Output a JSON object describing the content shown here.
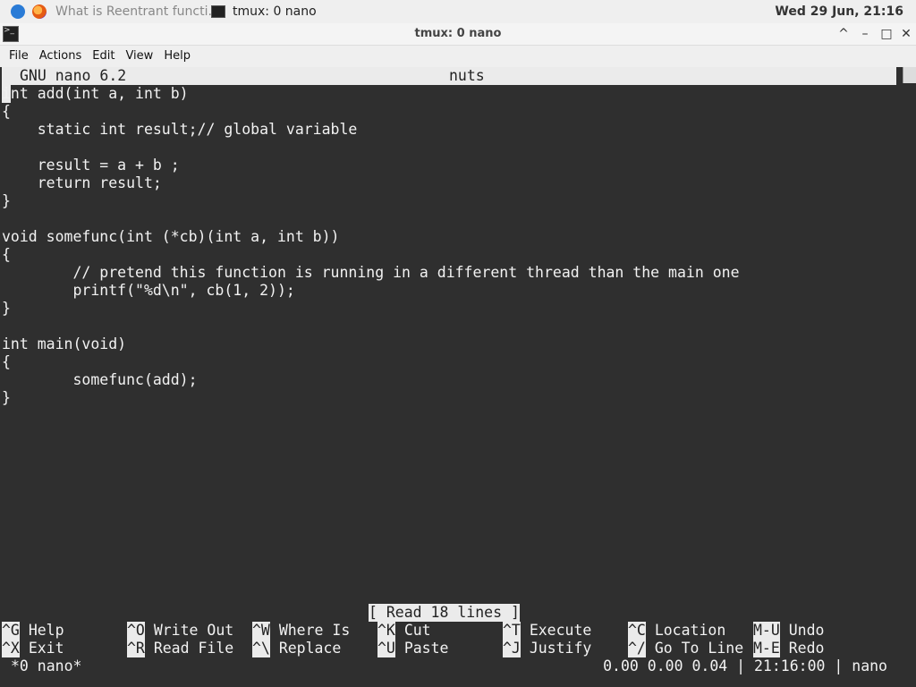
{
  "taskbar": {
    "firefox_task": "What is Reentrant functi...",
    "tmux_task": "tmux: 0 nano",
    "clock": "Wed 29 Jun, 21:16"
  },
  "window": {
    "title": "tmux: 0 nano",
    "buttons": {
      "up": "^",
      "minimize": "–",
      "maximize": "□",
      "close": "✕"
    }
  },
  "menu": [
    "File",
    "Actions",
    "Edit",
    "View",
    "Help"
  ],
  "nano": {
    "version": "GNU nano 6.2",
    "filename": "nuts",
    "code_lines": [
      "int add(int a, int b)",
      "{",
      "    static int result;// global variable",
      "",
      "    result = a + b ;",
      "    return result;",
      "}",
      "",
      "void somefunc(int (*cb)(int a, int b))",
      "{",
      "        // pretend this function is running in a different thread than the main one",
      "        printf(\"%d\\n\", cb(1, 2));",
      "}",
      "",
      "int main(void)",
      "{",
      "        somefunc(add);",
      "}"
    ],
    "status_message": "[ Read 18 lines ]",
    "shortcuts_row1": [
      {
        "key": "^G",
        "label": "Help"
      },
      {
        "key": "^O",
        "label": "Write Out"
      },
      {
        "key": "^W",
        "label": "Where Is"
      },
      {
        "key": "^K",
        "label": "Cut"
      },
      {
        "key": "^T",
        "label": "Execute"
      },
      {
        "key": "^C",
        "label": "Location"
      },
      {
        "key": "M-U",
        "label": "Undo"
      }
    ],
    "shortcuts_row2": [
      {
        "key": "^X",
        "label": "Exit"
      },
      {
        "key": "^R",
        "label": "Read File"
      },
      {
        "key": "^\\",
        "label": "Replace"
      },
      {
        "key": "^U",
        "label": "Paste"
      },
      {
        "key": "^J",
        "label": "Justify"
      },
      {
        "key": "^/",
        "label": "Go To Line"
      },
      {
        "key": "M-E",
        "label": "Redo"
      }
    ]
  },
  "tmux": {
    "window_label": "*0 nano*",
    "right_status": "0.00 0.00 0.04 | 21:16:00 | nano"
  }
}
